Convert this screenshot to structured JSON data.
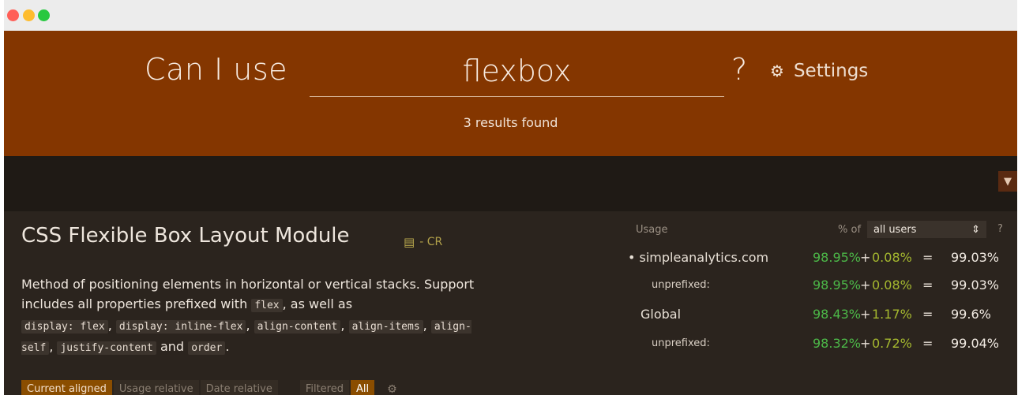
{
  "window": {
    "colors": {
      "close": "#ff5f57",
      "minimize": "#febc2e",
      "zoom": "#28c840"
    }
  },
  "header": {
    "title": "Can I use",
    "search_value": "flexbox",
    "question_mark": "?",
    "settings_label": "Settings",
    "results_text": "3 results found",
    "background": "#843600"
  },
  "feature": {
    "title": "CSS Flexible Box Layout Module",
    "spec_status": "- CR",
    "description_parts": {
      "intro": "Method of positioning elements in horizontal or vertical stacks. Support includes all properties prefixed with",
      "code_flex": "flex",
      "as_well_as": ", as well as",
      "code_display_flex": "display: flex",
      "code_display_inline_flex": "display: inline-flex",
      "code_align_content": "align-content",
      "code_align_items": "align-items",
      "code_align_self": "align-self",
      "code_justify_content": "justify-content",
      "and": "and",
      "code_order": "order",
      "period": "."
    }
  },
  "view_tabs": {
    "current_aligned": "Current aligned",
    "usage_relative": "Usage relative",
    "date_relative": "Date relative",
    "filtered": "Filtered",
    "all": "All"
  },
  "usage": {
    "label": "Usage",
    "pct_of": "% of",
    "selected_scope": "all users",
    "help": "?",
    "rows": [
      {
        "label": "• simpleanalytics.com",
        "supported": "98.95%",
        "plus": "+",
        "partial": "0.08%",
        "eq": "=",
        "total": "99.03%"
      },
      {
        "label": "unprefixed:",
        "supported": "98.95%",
        "plus": "+",
        "partial": "0.08%",
        "eq": "=",
        "total": "99.03%"
      },
      {
        "label": "Global",
        "supported": "98.43%",
        "plus": "+",
        "partial": "1.17%",
        "eq": "=",
        "total": "99.6%"
      },
      {
        "label": "unprefixed:",
        "supported": "98.32%",
        "plus": "+",
        "partial": "0.72%",
        "eq": "=",
        "total": "99.04%"
      }
    ],
    "colors": {
      "supported": "#4cb848",
      "partial": "#a5b82f"
    }
  }
}
